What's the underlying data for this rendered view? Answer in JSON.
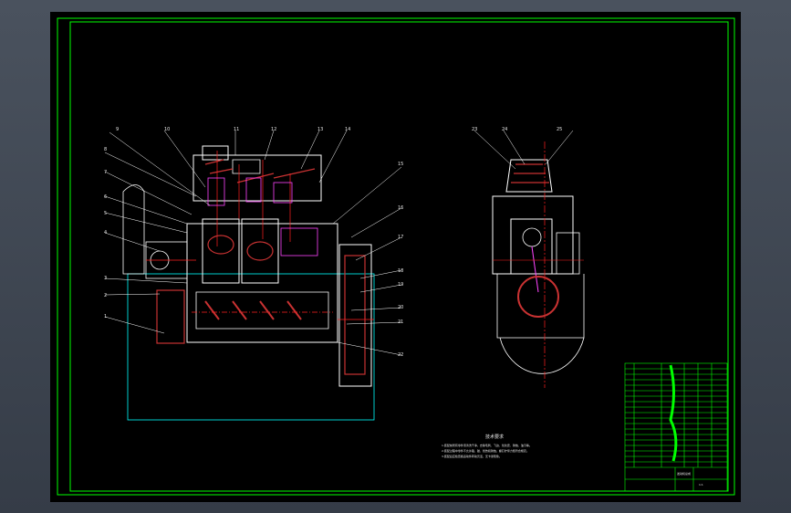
{
  "colors": {
    "frame": "#00ff00",
    "outline": "#ffffff",
    "centerline": "#ff2020",
    "section": "#c83232",
    "detail": "#ff44ff",
    "aux": "#00ffff",
    "dim": "#ffffff"
  },
  "part_numbers": [
    "1",
    "2",
    "3",
    "4",
    "5",
    "6",
    "7",
    "8",
    "9",
    "10",
    "11",
    "12",
    "13",
    "14",
    "15",
    "16",
    "17",
    "18",
    "19",
    "20",
    "21",
    "22",
    "23",
    "24",
    "25"
  ],
  "tech_notes": {
    "title": "技术要求",
    "lines": [
      "1.装配前所有零件须清洗干净，去除毛刺、飞边、氧化皮、锈蚀、油污等。",
      "2.装配过程中零件不允许磕、碰、划伤和锈蚀，螺钉拧紧力矩符合规定。",
      "3.装配后应检查各运动件转动灵活，无卡滞现象。"
    ]
  },
  "title_block": {
    "drawing_name": "发动机总成",
    "scale": "1:1"
  }
}
